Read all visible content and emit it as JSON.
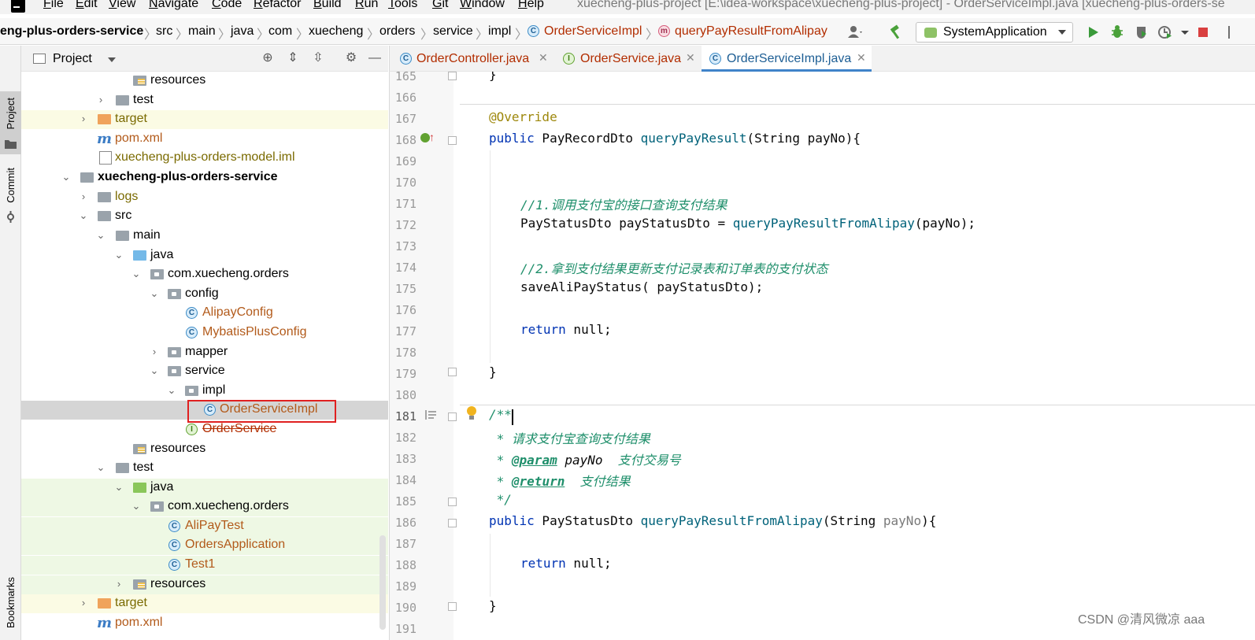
{
  "menu": {
    "items": [
      "File",
      "Edit",
      "View",
      "Navigate",
      "Code",
      "Refactor",
      "Build",
      "Run",
      "Tools",
      "Git",
      "Window",
      "Help"
    ],
    "window_title": "xuecheng-plus-project [E:\\idea-workspace\\xuecheng-plus-project] - OrderServiceImpl.java [xuecheng-plus-orders-se"
  },
  "breadcrumb": {
    "items": [
      "eng-plus-orders-service",
      "src",
      "main",
      "java",
      "com",
      "xuecheng",
      "orders",
      "service",
      "impl",
      "OrderServiceImpl",
      "queryPayResultFromAlipay"
    ]
  },
  "toolbar": {
    "run_config": "SystemApplication",
    "icons": [
      "user-icon",
      "hammer-icon",
      "run-icon",
      "debug-icon",
      "coverage-icon",
      "profile-icon",
      "stop-icon"
    ]
  },
  "side_stripe": {
    "project": "Project",
    "commit": "Commit",
    "bookmarks": "Bookmarks"
  },
  "project_panel": {
    "title": "Project",
    "tree": [
      {
        "label": "resources",
        "icon": "resources-folder"
      },
      {
        "label": "test",
        "icon": "folder"
      },
      {
        "label": "target",
        "icon": "excluded-folder"
      },
      {
        "label": "pom.xml",
        "icon": "maven"
      },
      {
        "label": "xuecheng-plus-orders-model.iml",
        "icon": "file"
      },
      {
        "label": "xuecheng-plus-orders-service",
        "icon": "module"
      },
      {
        "label": "logs",
        "icon": "folder"
      },
      {
        "label": "src",
        "icon": "folder"
      },
      {
        "label": "main",
        "icon": "folder"
      },
      {
        "label": "java",
        "icon": "source-folder"
      },
      {
        "label": "com.xuecheng.orders",
        "icon": "package"
      },
      {
        "label": "config",
        "icon": "package"
      },
      {
        "label": "AlipayConfig",
        "icon": "class"
      },
      {
        "label": "MybatisPlusConfig",
        "icon": "class"
      },
      {
        "label": "mapper",
        "icon": "package"
      },
      {
        "label": "service",
        "icon": "package"
      },
      {
        "label": "impl",
        "icon": "package"
      },
      {
        "label": "OrderServiceImpl",
        "icon": "class"
      },
      {
        "label": "OrderService",
        "icon": "interface"
      },
      {
        "label": "resources",
        "icon": "resources-folder"
      },
      {
        "label": "test",
        "icon": "folder"
      },
      {
        "label": "java",
        "icon": "test-folder"
      },
      {
        "label": "com.xuecheng.orders",
        "icon": "package"
      },
      {
        "label": "AliPayTest",
        "icon": "test-class"
      },
      {
        "label": "OrdersApplication",
        "icon": "test-class"
      },
      {
        "label": "Test1",
        "icon": "test-class"
      },
      {
        "label": "resources",
        "icon": "test-resources-folder"
      },
      {
        "label": "target",
        "icon": "excluded-folder"
      },
      {
        "label": "pom.xml",
        "icon": "maven"
      }
    ]
  },
  "editor": {
    "tabs": [
      {
        "label": "OrderController.java",
        "icon": "class"
      },
      {
        "label": "OrderService.java",
        "icon": "interface"
      },
      {
        "label": "OrderServiceImpl.java",
        "icon": "class",
        "active": true
      }
    ],
    "line_numbers": [
      "165",
      "166",
      "167",
      "168",
      "169",
      "170",
      "171",
      "172",
      "173",
      "174",
      "175",
      "176",
      "177",
      "178",
      "179",
      "180",
      "181",
      "182",
      "183",
      "184",
      "185",
      "186",
      "187",
      "188",
      "189",
      "190",
      "191"
    ],
    "code": {
      "l165": "}",
      "l167": "@Override",
      "l168_kw": "public",
      "l168_type": " PayRecordDto ",
      "l168_fn": "queryPayResult",
      "l168_rest": "(String payNo){",
      "l171": "//1.调用支付宝的接口查询支付结果",
      "l172_a": "PayStatusDto payStatusDto = ",
      "l172_fn": "queryPayResultFromAlipay",
      "l172_b": "(payNo);",
      "l174": "//2.拿到支付结果更新支付记录表和订单表的支付状态",
      "l175": "saveAliPayStatus( payStatusDto);",
      "l177_kw": "return",
      "l177_rest": " null;",
      "l179": "}",
      "l181": "/**",
      "l182": " * 请求支付宝查询支付结果",
      "l183_star": " * ",
      "l183_tag": "@param",
      "l183_name": " payNo",
      "l183_desc": "  支付交易号",
      "l184_star": " * ",
      "l184_tag": "@return",
      "l184_desc": "  支付结果",
      "l185": " */",
      "l186_kw": "public",
      "l186_type": " PayStatusDto ",
      "l186_fn": "queryPayResultFromAlipay",
      "l186_a": "(String ",
      "l186_param": "payNo",
      "l186_b": "){",
      "l188_kw": "return",
      "l188_rest": " null;",
      "l190": "}"
    }
  },
  "watermark": "CSDN @清风微凉 aaa"
}
